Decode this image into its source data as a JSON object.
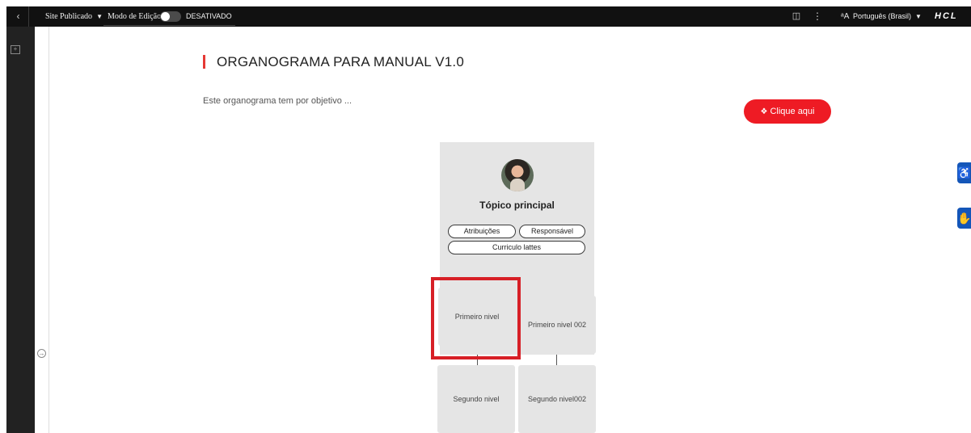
{
  "topbar": {
    "back_icon": "chevron-left-icon",
    "site_label": "Site Publicado",
    "edit_mode_label": "Modo de Edição:",
    "edit_mode_state": "DESATIVADO",
    "panel_icon": "panel-icon",
    "more_icon": "kebab-icon",
    "language_label": "Português (Brasil)",
    "logo_text": "HCL"
  },
  "page": {
    "title": "ORGANOGRAMA PARA MANUAL V1.0",
    "description": "Este organograma tem por objetivo ...",
    "cta_label": "Clique aqui",
    "accent_color": "#e53935",
    "cta_color": "#ee1b24"
  },
  "org": {
    "root": {
      "title": "Tópico principal",
      "buttons": [
        "Atribuições",
        "Responsável",
        "Curriculo lattes"
      ]
    },
    "level1": [
      "Primeiro nivel",
      "Primeiro nivel 002"
    ],
    "level2": [
      "Segundo nivel",
      "Segundo nivel002"
    ],
    "highlight_color": "#d71f26"
  },
  "floating": {
    "accessibility_icon": "accessibility-icon",
    "sign_language_icon": "sign-language-icon",
    "color": "#1456b8"
  }
}
